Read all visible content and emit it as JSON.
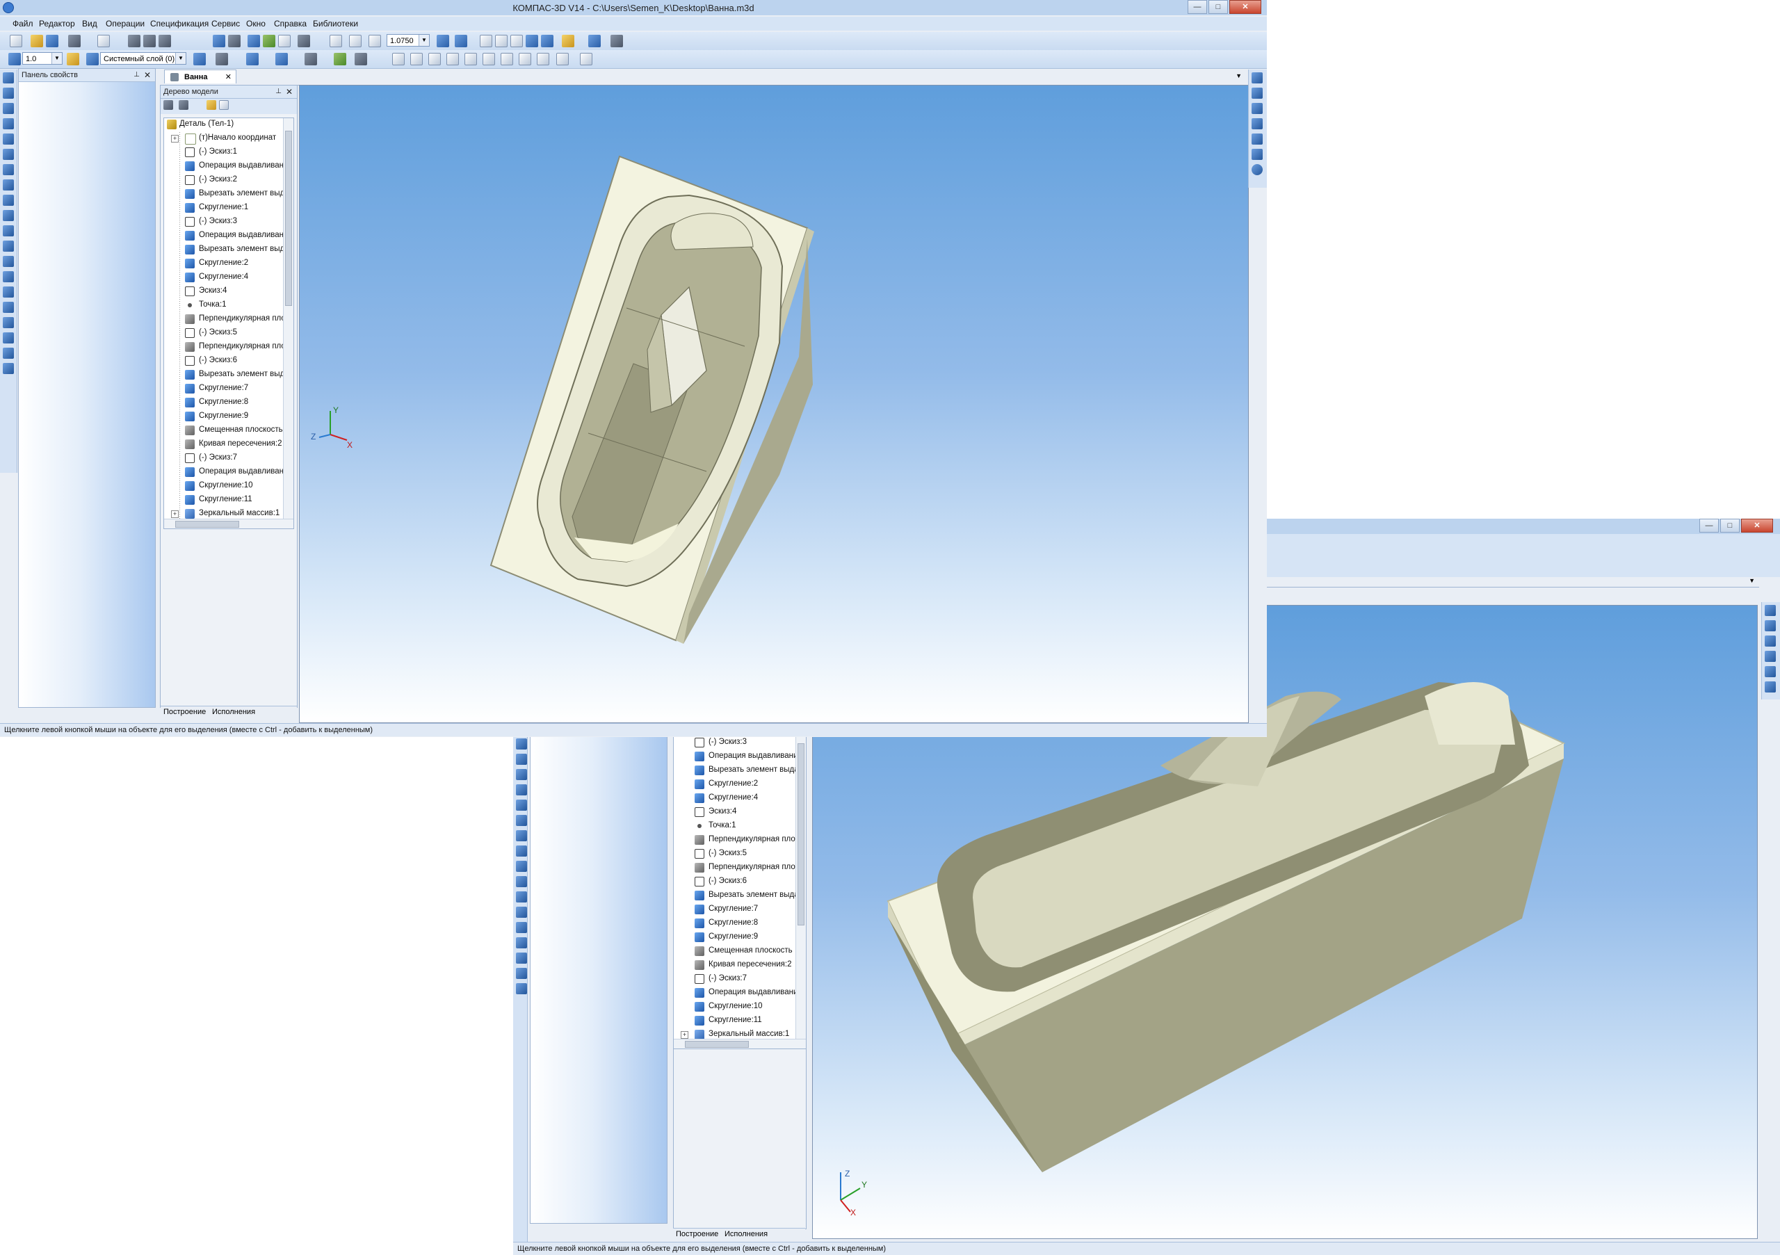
{
  "window": {
    "title": "КОМПАС-3D V14 - C:\\Users\\Semen_K\\Desktop\\Ванна.m3d",
    "minimize_label": "—",
    "maximize_label": "□",
    "close_label": "✕"
  },
  "menu": [
    "Файл",
    "Редактор",
    "Вид",
    "Операции",
    "Спецификация",
    "Сервис",
    "Окно",
    "Справка",
    "Библиотеки"
  ],
  "toolbar": {
    "zoom_value": "1.0750",
    "step_value": "1.0",
    "layer_value": "Системный слой (0)"
  },
  "properties_panel": {
    "title": "Панель свойств"
  },
  "model_tree": {
    "title": "Дерево модели",
    "items": [
      {
        "label": "Деталь (Тел-1)",
        "icon": "part-icon"
      },
      {
        "label": "(т)Начало координат",
        "icon": "origin-icon"
      },
      {
        "label": "(-) Эскиз:1",
        "icon": "sketch-icon"
      },
      {
        "label": "Операция выдавливания",
        "icon": "extrude-icon"
      },
      {
        "label": "(-) Эскиз:2",
        "icon": "sketch-icon"
      },
      {
        "label": "Вырезать элемент выдавливания",
        "icon": "cut-icon"
      },
      {
        "label": "Скругление:1",
        "icon": "fillet-icon"
      },
      {
        "label": "(-) Эскиз:3",
        "icon": "sketch-icon"
      },
      {
        "label": "Операция выдавливания",
        "icon": "extrude-icon"
      },
      {
        "label": "Вырезать элемент выдавливания",
        "icon": "cut-icon"
      },
      {
        "label": "Скругление:2",
        "icon": "fillet-icon"
      },
      {
        "label": "Скругление:4",
        "icon": "fillet-icon"
      },
      {
        "label": "Эскиз:4",
        "icon": "sketch-icon"
      },
      {
        "label": "Точка:1",
        "icon": "point-icon"
      },
      {
        "label": "Перпендикулярная плоскость",
        "icon": "plane-icon"
      },
      {
        "label": "(-) Эскиз:5",
        "icon": "sketch-icon"
      },
      {
        "label": "Перпендикулярная плоскость",
        "icon": "plane-icon"
      },
      {
        "label": "(-) Эскиз:6",
        "icon": "sketch-icon"
      },
      {
        "label": "Вырезать элемент выдавливания",
        "icon": "cut-icon"
      },
      {
        "label": "Скругление:7",
        "icon": "fillet-icon"
      },
      {
        "label": "Скругление:8",
        "icon": "fillet-icon"
      },
      {
        "label": "Скругление:9",
        "icon": "fillet-icon"
      },
      {
        "label": "Смещенная плоскость",
        "icon": "plane-icon"
      },
      {
        "label": "Кривая пересечения:2",
        "icon": "curve-icon"
      },
      {
        "label": "(-) Эскиз:7",
        "icon": "sketch-icon"
      },
      {
        "label": "Операция выдавливания",
        "icon": "extrude-icon"
      },
      {
        "label": "Скругление:10",
        "icon": "fillet-icon"
      },
      {
        "label": "Скругление:11",
        "icon": "fillet-icon"
      },
      {
        "label": "Зеркальный массив:1",
        "icon": "mirror-icon"
      }
    ],
    "bottom_tabs": [
      "Построение",
      "Исполнения"
    ]
  },
  "document_tab": {
    "label": "Ванна"
  },
  "axes": {
    "x": "X",
    "y": "Y",
    "z": "Z"
  },
  "status_text": "Щелкните левой кнопкой мыши на объекте для его выделения (вместе с Ctrl - добавить к выделенным)",
  "second_window": {
    "tree_first_index": 7,
    "tree_last_index": 28
  },
  "colors": {
    "model_light": "#f3f3e0",
    "model_shadow": "#8a8a72",
    "viewport_top": "#5f9edc",
    "viewport_bottom": "#ffffff"
  }
}
